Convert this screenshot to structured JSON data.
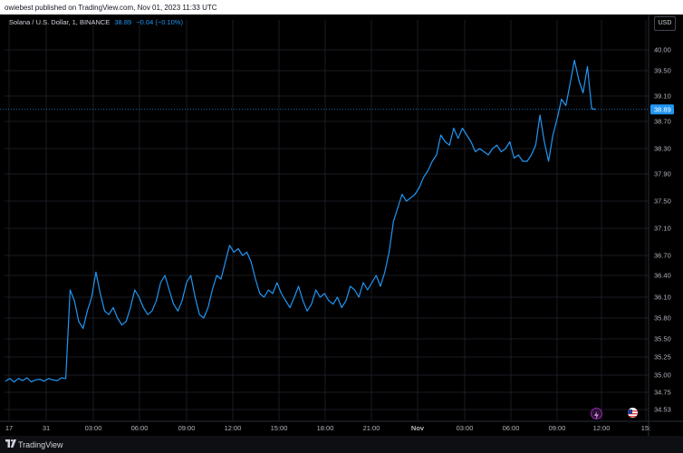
{
  "topbar": {
    "text": "owiebest published on TradingView.com, Nov 01, 2023 11:33 UTC"
  },
  "legend": {
    "symbol": "Solana / U.S. Dollar, 1, BINANCE",
    "price": "38.89",
    "change": "−0.04 (−0.10%)"
  },
  "currency": "USD",
  "footer": {
    "logo_icon": "tradingview-logo-icon",
    "brand": "TradingView"
  },
  "events": [
    {
      "icon": "lightning-icon",
      "color": "#9c27b0"
    },
    {
      "icon": "us-flag-icon",
      "color": "#2962ff"
    }
  ],
  "colors": {
    "line": "#2196f3",
    "price_label_bg": "#2196f3",
    "background": "#000000"
  },
  "chart_data": {
    "type": "line",
    "title": "Solana / U.S. Dollar, 1, BINANCE",
    "ylim": [
      34.4,
      40.1
    ],
    "y_ticks": [
      "40.00",
      "39.50",
      "39.10",
      "38.70",
      "38.30",
      "37.90",
      "37.50",
      "37.10",
      "36.70",
      "36.40",
      "36.10",
      "35.80",
      "35.50",
      "35.25",
      "35.00",
      "34.75",
      "34.53"
    ],
    "x_ticks": [
      "17",
      "31",
      "03:00",
      "06:00",
      "09:00",
      "12:00",
      "15:00",
      "18:00",
      "21:00",
      "Nov",
      "03:00",
      "06:00",
      "09:00",
      "12:00",
      "15:"
    ],
    "last_price_label": "38.89",
    "series": [
      {
        "values": [
          34.91,
          34.95,
          34.9,
          34.95,
          34.92,
          34.96,
          34.9,
          34.93,
          34.94,
          34.91,
          34.95,
          34.93,
          34.92,
          34.96,
          34.95,
          36.2,
          36.05,
          35.75,
          35.65,
          35.9,
          36.1,
          36.45,
          36.15,
          35.9,
          35.85,
          35.95,
          35.8,
          35.7,
          35.75,
          35.95,
          36.2,
          36.1,
          35.95,
          35.85,
          35.9,
          36.05,
          36.3,
          36.4,
          36.2,
          36.0,
          35.9,
          36.05,
          36.3,
          36.4,
          36.1,
          35.85,
          35.8,
          35.95,
          36.2,
          36.4,
          36.35,
          36.6,
          36.85,
          36.75,
          36.8,
          36.7,
          36.75,
          36.6,
          36.35,
          36.15,
          36.1,
          36.2,
          36.15,
          36.3,
          36.15,
          36.05,
          35.95,
          36.1,
          36.25,
          36.05,
          35.9,
          36.0,
          36.2,
          36.1,
          36.15,
          36.05,
          36.0,
          36.1,
          35.95,
          36.05,
          36.25,
          36.2,
          36.1,
          36.3,
          36.2,
          36.3,
          36.4,
          36.25,
          36.45,
          36.75,
          37.2,
          37.4,
          37.6,
          37.5,
          37.55,
          37.6,
          37.7,
          37.85,
          37.95,
          38.1,
          38.2,
          38.5,
          38.4,
          38.35,
          38.6,
          38.45,
          38.6,
          38.5,
          38.4,
          38.25,
          38.3,
          38.25,
          38.2,
          38.3,
          38.35,
          38.25,
          38.3,
          38.4,
          38.15,
          38.2,
          38.1,
          38.1,
          38.2,
          38.35,
          38.8,
          38.4,
          38.1,
          38.5,
          38.75,
          39.05,
          38.95,
          39.3,
          39.75,
          39.35,
          39.15,
          39.6,
          38.9,
          38.89
        ]
      }
    ]
  }
}
